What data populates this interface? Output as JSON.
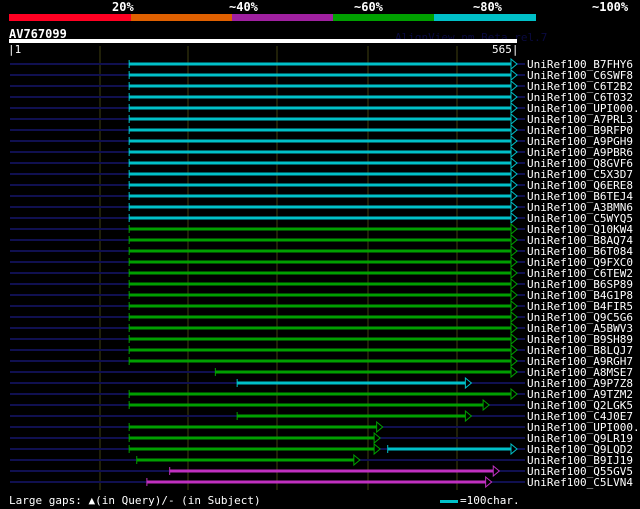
{
  "scale": {
    "labels": [
      "20%",
      "~40%",
      "~60%",
      "~80%",
      "~100%"
    ],
    "colors": [
      "#ff0022",
      "#e06000",
      "#a020a0",
      "#00a000",
      "#00c0c8"
    ]
  },
  "query": {
    "accession": "AV767099",
    "version": "AlignView.pm Beta rel.7",
    "start": "|1",
    "end": "565|",
    "length": 565
  },
  "colors": {
    "cyan": "#00c0c8",
    "green": "#00a000",
    "magenta": "#c030c0",
    "background_line": "#101050",
    "grid": "#404010"
  },
  "hits": [
    {
      "name": "UniRef100_B7FHY6",
      "color": "cyan",
      "s": 0.235,
      "e": 1
    },
    {
      "name": "UniRef100_C6SWF8",
      "color": "cyan",
      "s": 0.235,
      "e": 1
    },
    {
      "name": "UniRef100_C6T2B2",
      "color": "cyan",
      "s": 0.235,
      "e": 1
    },
    {
      "name": "UniRef100_C6T032",
      "color": "cyan",
      "s": 0.235,
      "e": 1
    },
    {
      "name": "UniRef100_UPI000..",
      "color": "cyan",
      "s": 0.235,
      "e": 1
    },
    {
      "name": "UniRef100_A7PRL3",
      "color": "cyan",
      "s": 0.235,
      "e": 1
    },
    {
      "name": "UniRef100_B9RFP0",
      "color": "cyan",
      "s": 0.235,
      "e": 1
    },
    {
      "name": "UniRef100_A9PGH9",
      "color": "cyan",
      "s": 0.235,
      "e": 1
    },
    {
      "name": "UniRef100_A9PBR6",
      "color": "cyan",
      "s": 0.235,
      "e": 1
    },
    {
      "name": "UniRef100_Q8GVF6",
      "color": "cyan",
      "s": 0.235,
      "e": 1
    },
    {
      "name": "UniRef100_C5X3D7",
      "color": "cyan",
      "s": 0.235,
      "e": 1
    },
    {
      "name": "UniRef100_Q6ERE8",
      "color": "cyan",
      "s": 0.235,
      "e": 1
    },
    {
      "name": "UniRef100_B6TEJ4",
      "color": "cyan",
      "s": 0.235,
      "e": 1
    },
    {
      "name": "UniRef100_A3BMN6",
      "color": "cyan",
      "s": 0.235,
      "e": 1
    },
    {
      "name": "UniRef100_C5WYQ5",
      "color": "cyan",
      "s": 0.235,
      "e": 1
    },
    {
      "name": "UniRef100_Q10KW4",
      "color": "green",
      "s": 0.235,
      "e": 1
    },
    {
      "name": "UniRef100_B8AQ74",
      "color": "green",
      "s": 0.235,
      "e": 1
    },
    {
      "name": "UniRef100_B6T084",
      "color": "green",
      "s": 0.235,
      "e": 1
    },
    {
      "name": "UniRef100_Q9FXC0",
      "color": "green",
      "s": 0.235,
      "e": 1
    },
    {
      "name": "UniRef100_C6TEW2",
      "color": "green",
      "s": 0.235,
      "e": 1
    },
    {
      "name": "UniRef100_B6SP89",
      "color": "green",
      "s": 0.235,
      "e": 1
    },
    {
      "name": "UniRef100_B4G1P8",
      "color": "green",
      "s": 0.235,
      "e": 1
    },
    {
      "name": "UniRef100_B4FIR5",
      "color": "green",
      "s": 0.235,
      "e": 1
    },
    {
      "name": "UniRef100_Q9C5G6",
      "color": "green",
      "s": 0.235,
      "e": 1
    },
    {
      "name": "UniRef100_A5BWV3",
      "color": "green",
      "s": 0.235,
      "e": 1
    },
    {
      "name": "UniRef100_B9SH89",
      "color": "green",
      "s": 0.235,
      "e": 1
    },
    {
      "name": "UniRef100_B8LQJ7",
      "color": "green",
      "s": 0.235,
      "e": 1
    },
    {
      "name": "UniRef100_A9RGH7",
      "color": "green",
      "s": 0.235,
      "e": 1
    },
    {
      "name": "UniRef100_A8MSE7",
      "color": "green",
      "s": 0.405,
      "e": 1
    },
    {
      "name": "UniRef100_A9P7Z8",
      "color": "cyan",
      "s": 0.448,
      "e": 0.91
    },
    {
      "name": "UniRef100_A9TZM2",
      "color": "green",
      "s": 0.235,
      "e": 1
    },
    {
      "name": "UniRef100_Q2LGK5",
      "color": "green",
      "s": 0.235,
      "e": 0.945
    },
    {
      "name": "UniRef100_C4J0E7",
      "color": "green",
      "s": 0.448,
      "e": 0.91
    },
    {
      "name": "UniRef100_UPI000..",
      "color": "green",
      "s": 0.235,
      "e": 0.735
    },
    {
      "name": "UniRef100_Q9LR19",
      "color": "green",
      "s": 0.235,
      "e": 0.73
    },
    {
      "name": "UniRef100_Q9LQD2",
      "color": "green",
      "s": 0.235,
      "e": 0.73,
      "s2": 0.745,
      "e2": 1,
      "color2": "cyan"
    },
    {
      "name": "UniRef100_B9IJ19",
      "color": "green",
      "s": 0.25,
      "e": 0.69
    },
    {
      "name": "UniRef100_Q55GV5",
      "color": "magenta",
      "s": 0.315,
      "e": 0.965
    },
    {
      "name": "UniRef100_C5LVN4",
      "color": "magenta",
      "s": 0.27,
      "e": 0.95
    }
  ],
  "footer": {
    "gaps": "Large gaps: ▲(in Query)/- (in Subject)",
    "legend": "=100char."
  }
}
